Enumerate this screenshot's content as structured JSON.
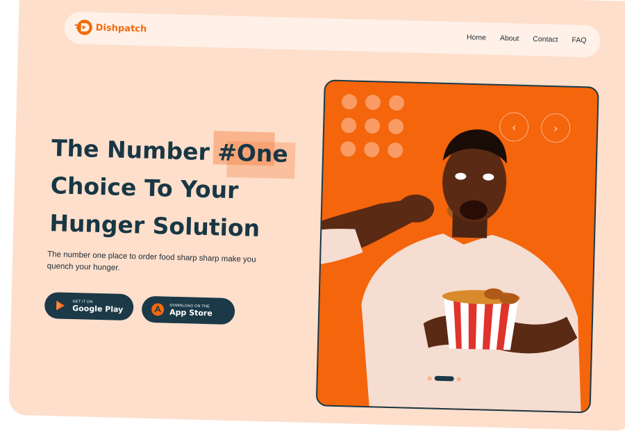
{
  "brand": {
    "name": "Dishpatch",
    "color": "#f26a0b"
  },
  "nav": {
    "links": [
      "Home",
      "About",
      "Contact",
      "FAQ"
    ]
  },
  "hero": {
    "line1": "The Number",
    "highlight": "#One",
    "line2": "Choice To Your",
    "line3": "Hunger Solution",
    "subtext": "The number one place to order food sharp sharp make you quench your hunger."
  },
  "store_buttons": {
    "google": {
      "small": "GET IT ON",
      "big": "Google Play",
      "icon": "play-store-icon"
    },
    "apple": {
      "small": "DOWNLOAD ON THE",
      "big": "App Store",
      "icon": "app-store-icon"
    }
  },
  "carousel": {
    "prev_icon": "chevron-left-icon",
    "next_icon": "chevron-right-icon",
    "prev": "‹",
    "next": "›"
  },
  "colors": {
    "background": "#fddfcc",
    "accent": "#f4650c",
    "dark": "#1b3947",
    "navbar": "#fff1e8"
  }
}
